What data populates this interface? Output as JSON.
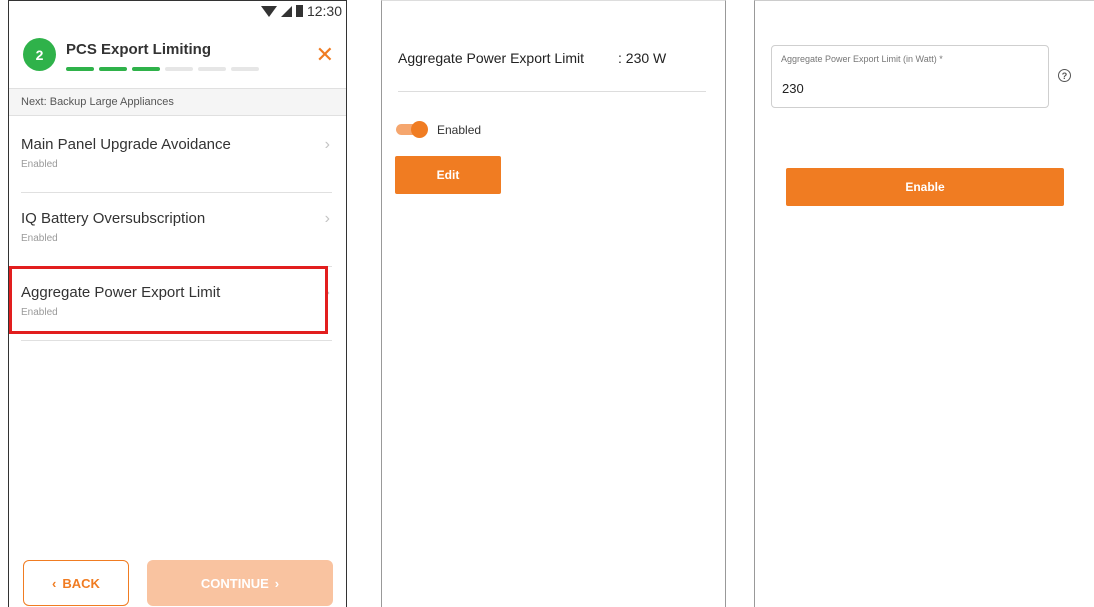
{
  "phone": {
    "status_bar": {
      "time": "12:30",
      "icons": [
        "wifi-icon",
        "signal-icon",
        "battery-icon"
      ]
    },
    "header": {
      "step_number": "2",
      "title": "PCS Export Limiting",
      "progress": {
        "segments_total": 6,
        "segments_complete": 3
      },
      "close_icon": "✕"
    },
    "next_label": "Next: Backup Large Appliances",
    "items": [
      {
        "label": "Main Panel Upgrade Avoidance",
        "status": "Enabled",
        "chevron": "›"
      },
      {
        "label": "IQ Battery Oversubscription",
        "status": "Enabled",
        "chevron": "›"
      },
      {
        "label": "Aggregate Power Export Limit",
        "status": "Enabled",
        "chevron": "›",
        "highlighted": true
      }
    ],
    "footer": {
      "back_label": "BACK",
      "back_icon": "‹",
      "continue_label": "CONTINUE",
      "continue_icon": "›"
    }
  },
  "detail": {
    "label": "Aggregate Power Export Limit",
    "value": ": 230 W",
    "toggle": {
      "on": true,
      "label": "Enabled"
    },
    "edit_label": "Edit"
  },
  "edit_form": {
    "field_label": "Aggregate Power Export Limit (in Watt) *",
    "field_value": "230",
    "help_icon": "?",
    "enable_label": "Enable"
  },
  "colors": {
    "accent": "#f07c22",
    "step_green": "#2fb24a",
    "highlight_red": "#e21e1e",
    "continue_disabled": "#f9c3a0"
  }
}
